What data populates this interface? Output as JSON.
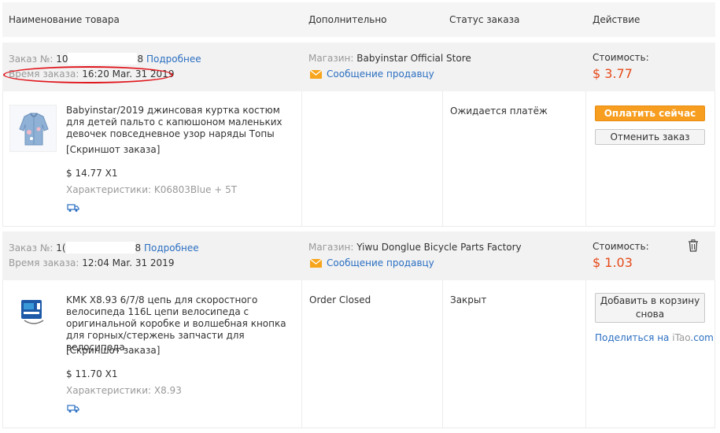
{
  "columns": {
    "product": "Наименование товара",
    "extra": "Дополнительно",
    "status": "Статус заказа",
    "action": "Действие"
  },
  "orders": [
    {
      "order_label": "Заказ №:",
      "order_prefix": "10",
      "order_suffix": "8",
      "details_link": "Подробнее",
      "time_label": "Время заказа:",
      "time_value": "16:20 Mar. 31 2019",
      "store_label": "Магазин:",
      "store_name": "Babyinstar Official Store",
      "message_link": "Сообщение продавцу",
      "cost_label": "Стоимость:",
      "cost_value": "$ 3.77",
      "item": {
        "title": "Babyinstar/2019 джинсовая куртка костюм для детей пальто с капюшоном маленьких девочек повседневное узор наряды Топы",
        "snapshot": "[Скриншот заказа]",
        "price_qty": "$ 14.77 X1",
        "specs_label": "Характеристики:",
        "specs_value": "K06803Blue + 5T",
        "extra_status": "",
        "status": "Ожидается платёж"
      },
      "pay_button": "Оплатить сейчас",
      "cancel_button": "Отменить заказ"
    },
    {
      "order_label": "Заказ №:",
      "order_prefix": "1(",
      "order_suffix": "8",
      "details_link": "Подробнее",
      "time_label": "Время заказа:",
      "time_value": "12:04 Mar. 31 2019",
      "store_label": "Магазин:",
      "store_name": "Yiwu Donglue Bicycle Parts Factory",
      "message_link": "Сообщение продавцу",
      "cost_label": "Стоимость:",
      "cost_value": "$ 1.03",
      "item": {
        "title": "KMK X8.93 6/7/8 цепь для скоростного велосипеда 116L цепи велосипеда с оригинальной коробке и волшебная кнопка для горных/стержень запчасти для велосипеда",
        "snapshot": "[Скриншот заказа]",
        "price_qty": "$ 11.70 X1",
        "specs_label": "Характеристики:",
        "specs_value": "X8.93",
        "extra_status": "Order Closed",
        "status": "Закрыт"
      },
      "add_to_cart_button": "Добавить в корзину снова",
      "share_prefix": "Поделиться на ",
      "share_brand": "iTao",
      "share_suffix": ".com"
    }
  ],
  "colors": {
    "accent_orange": "#f79d1f",
    "price_red": "#e64a19",
    "link_blue": "#2b6fc2",
    "highlight_red": "#e0161d"
  }
}
